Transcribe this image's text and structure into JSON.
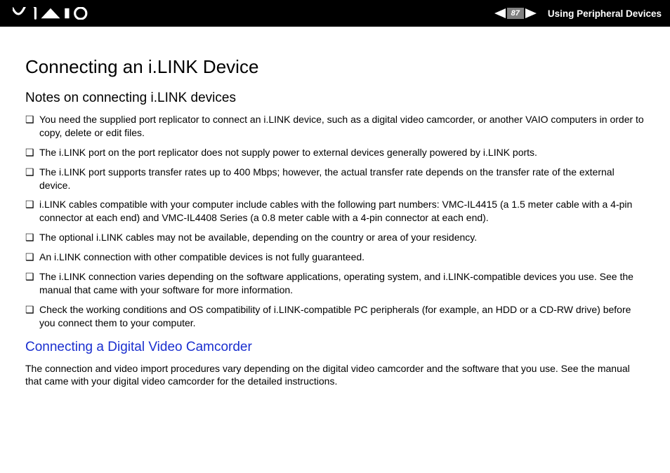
{
  "header": {
    "page_number": "87",
    "section": "Using Peripheral Devices"
  },
  "content": {
    "title": "Connecting an i.LINK Device",
    "subtitle": "Notes on connecting i.LINK devices",
    "notes": [
      "You need the supplied port replicator to connect an i.LINK device, such as a digital video camcorder, or another VAIO computers in order to copy, delete or edit files.",
      "The i.LINK port on the port replicator does not supply power to external devices generally powered by i.LINK ports.",
      "The i.LINK port supports transfer rates up to 400 Mbps; however, the actual transfer rate depends on the transfer rate of the external device.",
      "i.LINK cables compatible with your computer include cables with the following part numbers:\nVMC-IL4415 (a 1.5 meter cable with a 4-pin connector at each end) and VMC-IL4408 Series (a 0.8 meter cable with a 4-pin connector at each end).",
      "The optional i.LINK cables may not be available, depending on the country or area of your residency.",
      "An i.LINK connection with other compatible devices is not fully guaranteed.",
      "The i.LINK connection varies depending on the software applications, operating system, and i.LINK-compatible devices you use. See the manual that came with your software for more information.",
      "Check the working conditions and OS compatibility of i.LINK-compatible PC peripherals (for example, an HDD or a CD-RW drive) before you connect them to your computer."
    ],
    "subsection_title": "Connecting a Digital Video Camcorder",
    "subsection_body": "The connection and video import procedures vary depending on the digital video camcorder and the software that you use. See the manual that came with your digital video camcorder for the detailed instructions."
  }
}
